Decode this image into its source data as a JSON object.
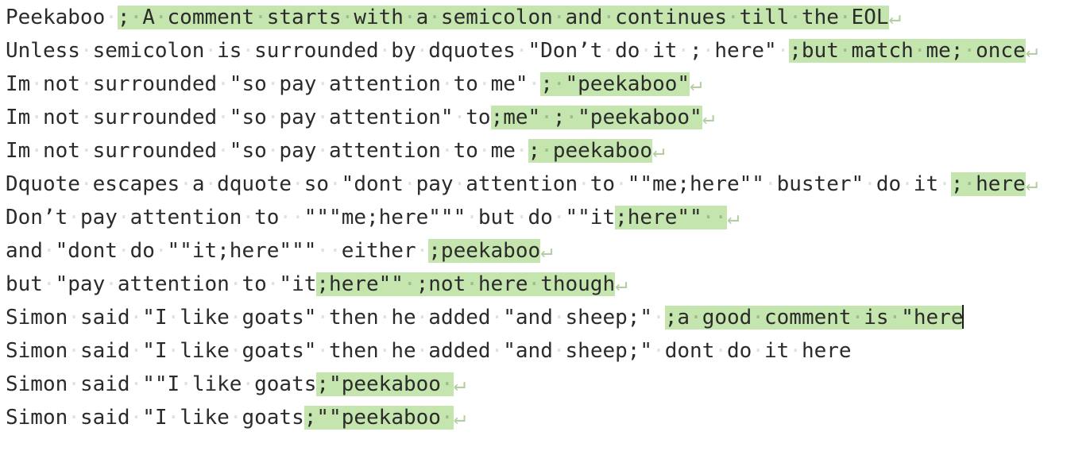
{
  "editor": {
    "name": "regex-match-preview",
    "background_color": "#ffffff",
    "text_color": "#2b2b2b",
    "highlight_color": "#c4e5ad",
    "space_dot_color": "#dde3dc",
    "highlight_space_dot_color": "#9bbb8c",
    "eol_marker_color": "#b3cea4",
    "eol_marker_glyph": "↵",
    "space_glyph": "·",
    "caret_color": "#1a1a1a",
    "font_size_px": 26,
    "line_height_px": 42,
    "line_count": 13
  },
  "lines": [
    {
      "index": 1,
      "plain": "Peekaboo ; A comment starts with a semicolon and continues till the EOL",
      "eol": true,
      "caret": false,
      "runs": [
        {
          "text": "Peekaboo·",
          "hl": false
        },
        {
          "text": ";·A·comment·starts·with·a·semicolon·and·continues·till·the·EOL",
          "hl": true
        }
      ]
    },
    {
      "index": 2,
      "plain": "Unless semicolon is surrounded by dquotes \"Don't do it ; here\" ;but match me; once",
      "eol": true,
      "caret": false,
      "runs": [
        {
          "text": "Unless·semicolon·is·surrounded·by·dquotes·\"Don’t·do·it·;·here\"·",
          "hl": false
        },
        {
          "text": ";but·match·me;·once",
          "hl": true
        }
      ]
    },
    {
      "index": 3,
      "plain": "Im not surrounded \"so pay attention to me\" ; \"peekaboo\"",
      "eol": true,
      "caret": false,
      "runs": [
        {
          "text": "Im·not·surrounded·\"so·pay·attention·to·me\"·",
          "hl": false
        },
        {
          "text": ";·\"peekaboo\"",
          "hl": true
        }
      ]
    },
    {
      "index": 4,
      "plain": "Im not surrounded \"so pay attention\" to;me\" ; \"peekaboo\"",
      "eol": true,
      "caret": false,
      "runs": [
        {
          "text": "Im·not·surrounded·\"so·pay·attention\"·to",
          "hl": false
        },
        {
          "text": ";me\"·;·\"peekaboo\"",
          "hl": true
        }
      ]
    },
    {
      "index": 5,
      "plain": "Im not surrounded \"so pay attention to me ; peekaboo",
      "eol": true,
      "caret": false,
      "runs": [
        {
          "text": "Im·not·surrounded·\"so·pay·attention·to·me·",
          "hl": false
        },
        {
          "text": ";·peekaboo",
          "hl": true
        }
      ]
    },
    {
      "index": 6,
      "plain": "Dquote escapes a dquote so \"dont pay attention to \"\"me;here\"\" buster\" do it ; here",
      "eol": true,
      "caret": false,
      "runs": [
        {
          "text": "Dquote·escapes·a·dquote·so·\"dont·pay·attention·to·\"\"me;here\"\"·buster\"·do·it·",
          "hl": false
        },
        {
          "text": ";·here",
          "hl": true
        }
      ]
    },
    {
      "index": 7,
      "plain": "Don't pay attention to  \"\"\"me;here\"\"\" but do \"\"it;here\"\"",
      "eol": true,
      "caret": false,
      "runs": [
        {
          "text": "Don’t·pay·attention·to··\"\"\"me;here\"\"\"·but·do·\"\"it",
          "hl": false
        },
        {
          "text": ";here\"\"··",
          "hl": true
        }
      ]
    },
    {
      "index": 8,
      "plain": "and \"dont do \"\"it;here\"\"\"  either ;peekaboo",
      "eol": true,
      "caret": false,
      "runs": [
        {
          "text": "and·\"dont·do·\"\"it;here\"\"\"··either·",
          "hl": false
        },
        {
          "text": ";peekaboo",
          "hl": true
        }
      ]
    },
    {
      "index": 9,
      "plain": "but \"pay attention to \"it;here\"\" ;not here though",
      "eol": true,
      "caret": false,
      "runs": [
        {
          "text": "but·\"pay·attention·to·\"it",
          "hl": false
        },
        {
          "text": ";here\"\"·;not·here·though",
          "hl": true
        }
      ]
    },
    {
      "index": 10,
      "plain": "Simon said \"I like goats\" then he added \"and sheep;\" ;a good comment is \"here",
      "eol": false,
      "caret": true,
      "runs": [
        {
          "text": "Simon·said·\"I·like·goats\"·then·he·added·\"and·sheep;\"·",
          "hl": false
        },
        {
          "text": ";a·good·comment·is·\"here",
          "hl": true
        }
      ]
    },
    {
      "index": 11,
      "plain": "Simon said \"I like goats\" then he added \"and sheep;\" dont do it here",
      "eol": false,
      "caret": false,
      "runs": [
        {
          "text": "Simon·said·\"I·like·goats\"·then·he·added·\"and·sheep;\"·dont·do·it·here",
          "hl": false
        }
      ]
    },
    {
      "index": 12,
      "plain": "Simon said \"\"I like goats;\"peekaboo",
      "eol": true,
      "caret": false,
      "runs": [
        {
          "text": "Simon·said·\"\"I·like·goats",
          "hl": false
        },
        {
          "text": ";\"peekaboo·",
          "hl": true
        }
      ]
    },
    {
      "index": 13,
      "plain": "Simon said \"I like goats;\"\"peekaboo",
      "eol": true,
      "caret": false,
      "runs": [
        {
          "text": "Simon·said·\"I·like·goats",
          "hl": false
        },
        {
          "text": ";\"\"peekaboo·",
          "hl": true
        }
      ]
    }
  ]
}
